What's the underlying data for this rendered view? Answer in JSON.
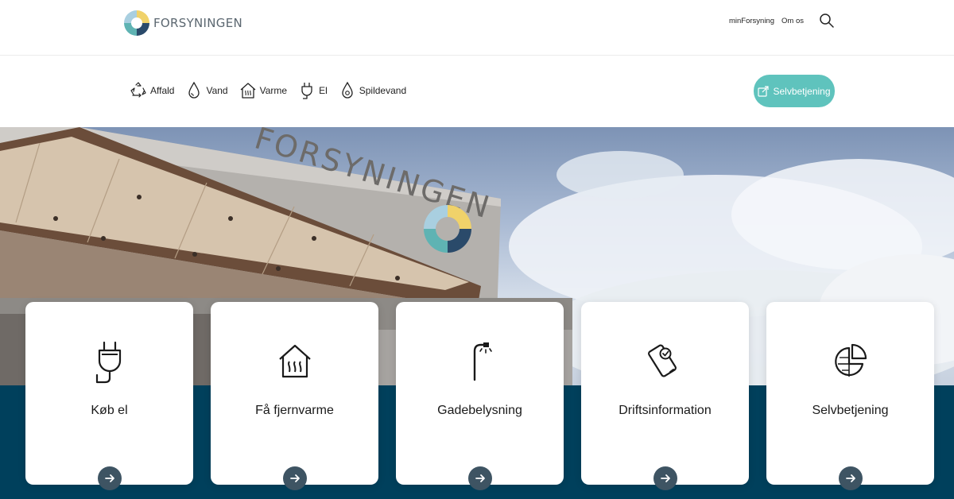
{
  "brand": {
    "name": "FORSYNINGEN",
    "colors": {
      "yellow": "#f0d26a",
      "teal": "#5fb3b3",
      "navy": "#2a4a6a",
      "accent": "#5fc3bd",
      "band": "#00405c"
    }
  },
  "top_links": {
    "my": "minForsyning",
    "about": "Om os",
    "search_icon": "search-icon"
  },
  "categories": [
    {
      "label": "Affald",
      "icon": "recycle-icon"
    },
    {
      "label": "Vand",
      "icon": "water-drop-icon"
    },
    {
      "label": "Varme",
      "icon": "house-heat-icon"
    },
    {
      "label": "El",
      "icon": "plug-icon"
    },
    {
      "label": "Spildevand",
      "icon": "wastewater-drop-icon"
    }
  ],
  "self_service_button": {
    "label": "Selvbetjening",
    "icon": "external-link-icon"
  },
  "hero": {
    "building_sign": "FORSYNINGEN"
  },
  "cards": [
    {
      "title": "Køb el",
      "icon": "plug-icon"
    },
    {
      "title": "Få fjernvarme",
      "icon": "house-heat-icon"
    },
    {
      "title": "Gadebelysning",
      "icon": "street-lamp-icon"
    },
    {
      "title": "Driftsinformation",
      "icon": "phone-check-icon"
    },
    {
      "title": "Selvbetjening",
      "icon": "pie-chart-icon"
    }
  ]
}
